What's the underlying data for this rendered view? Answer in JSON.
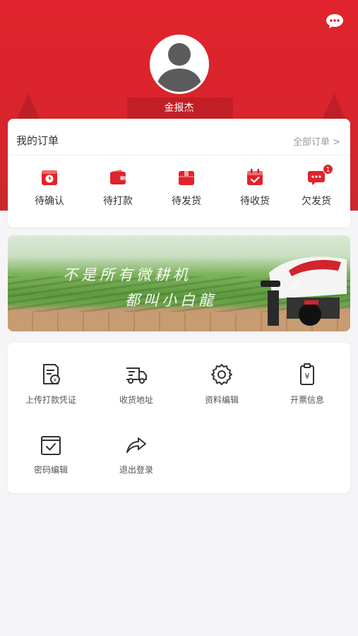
{
  "profile": {
    "username": "金报杰",
    "avatar_icon": "user-avatar-icon",
    "message_icon": "chat-bubble-icon"
  },
  "colors": {
    "brand_red": "#e0232c",
    "text_primary": "#333333",
    "text_secondary": "#999999"
  },
  "orders": {
    "title": "我的订单",
    "view_all": "全部订单 >",
    "items": [
      {
        "label": "待确认",
        "icon": "clock-box-icon"
      },
      {
        "label": "待打款",
        "icon": "wallet-icon"
      },
      {
        "label": "待发货",
        "icon": "package-icon"
      },
      {
        "label": "待收货",
        "icon": "calendar-check-icon"
      },
      {
        "label": "欠发货",
        "icon": "message-dots-icon",
        "badge": "1"
      }
    ]
  },
  "banner": {
    "line1": "不是所有微耕机",
    "line2": "都叫小白龍"
  },
  "services": {
    "items": [
      {
        "label": "上传打款凭证",
        "icon": "payment-receipt-icon"
      },
      {
        "label": "收货地址",
        "icon": "delivery-truck-icon"
      },
      {
        "label": "资料编辑",
        "icon": "settings-gear-icon"
      },
      {
        "label": "开票信息",
        "icon": "invoice-clipboard-icon"
      },
      {
        "label": "密码编辑",
        "icon": "password-check-icon"
      },
      {
        "label": "退出登录",
        "icon": "logout-share-icon"
      }
    ]
  }
}
